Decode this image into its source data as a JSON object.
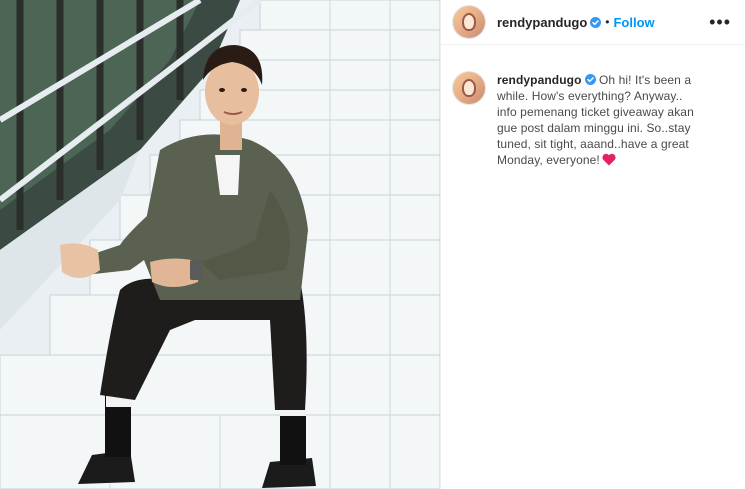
{
  "post": {
    "username": "rendypandugo",
    "separator": "•",
    "follow_label": "Follow",
    "more_label": "•••",
    "caption_line1": "Oh hi! It's been a",
    "caption_line2": "while. How's everything? Anyway..",
    "caption_line3": "info pemenang ticket giveaway akan",
    "caption_line4": "gue post dalam minggu ini. So..stay",
    "caption_line5": "tuned, sit tight, aaand..have a great",
    "caption_line6": "Monday, everyone!",
    "heart_emoji_icon": "red-heart-icon",
    "verified_icon": "verified-badge-icon"
  },
  "colors": {
    "link_blue": "#0095f6",
    "heart_red": "#e0245e",
    "text": "#262626"
  }
}
